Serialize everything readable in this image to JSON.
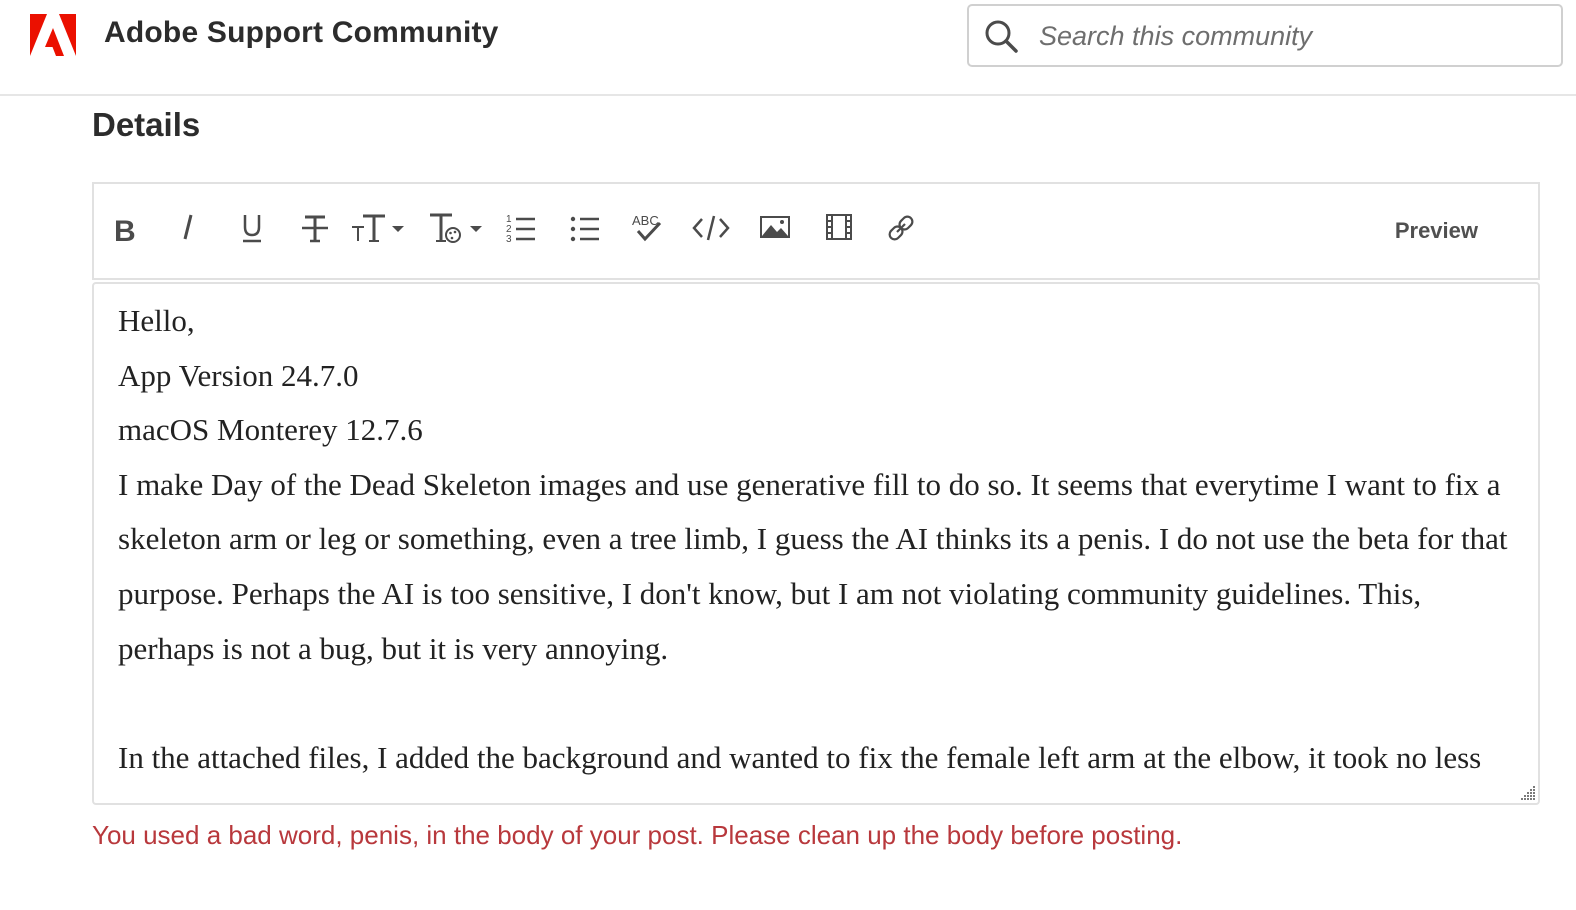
{
  "header": {
    "site_title": "Adobe Support Community",
    "search_placeholder": "Search this community"
  },
  "section": {
    "title": "Details"
  },
  "toolbar": {
    "buttons": [
      {
        "name": "bold",
        "icon": "bold-icon"
      },
      {
        "name": "italic",
        "icon": "italic-icon"
      },
      {
        "name": "underline",
        "icon": "underline-icon"
      },
      {
        "name": "strikethrough",
        "icon": "strikethrough-icon"
      },
      {
        "name": "font-size",
        "icon": "font-size-icon"
      },
      {
        "name": "text-format",
        "icon": "text-format-icon"
      },
      {
        "name": "numbered-list",
        "icon": "numbered-list-icon"
      },
      {
        "name": "bulleted-list",
        "icon": "bulleted-list-icon"
      },
      {
        "name": "spell-check",
        "icon": "spell-check-icon"
      },
      {
        "name": "code",
        "icon": "code-icon"
      },
      {
        "name": "image",
        "icon": "image-icon"
      },
      {
        "name": "video",
        "icon": "video-icon"
      },
      {
        "name": "link",
        "icon": "link-icon"
      }
    ],
    "preview_label": "Preview"
  },
  "editor": {
    "line1": "Hello,",
    "line2": "App Version 24.7.0",
    "line3": "macOS Monterey 12.7.6",
    "paragraph1": "I make Day of the Dead Skeleton images and use generative fill to do so. It seems that everytime I want to fix a skeleton arm or leg or something, even a tree limb, I guess the AI thinks its a penis. I do not use the beta for that purpose. Perhaps the AI is too sensitive, I don't know, but I am not violating community guidelines. This, perhaps is not a bug, but it is very annoying.",
    "paragraph2": "In the attached files, I added the background and wanted to fix the female left arm at the elbow, it took no less"
  },
  "error": {
    "message": "You used a bad word, penis, in the body of your post. Please clean up the body before posting."
  },
  "colors": {
    "brand_red": "#eb1000",
    "error_red": "#b8383c"
  }
}
